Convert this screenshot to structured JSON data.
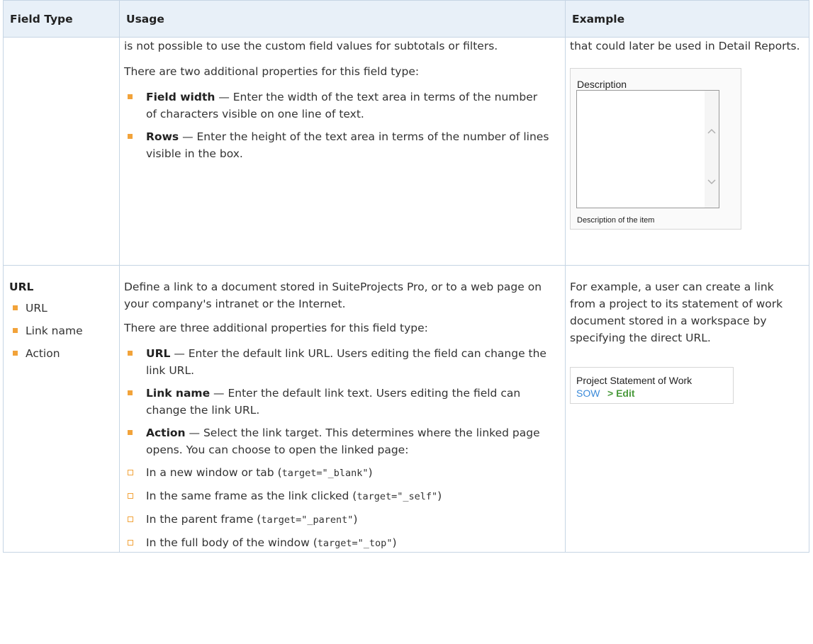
{
  "headers": {
    "field_type": "Field Type",
    "usage": "Usage",
    "example": "Example"
  },
  "row1": {
    "usage_intro": "is not possible to use the custom field values for subtotals or filters.",
    "usage_props_intro": "There are two additional properties for this field type:",
    "bullets": [
      {
        "term": "Field width",
        "text": " — Enter the width of the text area in terms of the number of characters visible on one line of text."
      },
      {
        "term": "Rows",
        "text": " — Enter the height of the text area in terms of the number of lines visible in the box."
      }
    ],
    "example_text": "that could later be used in Detail Reports.",
    "example_widget": {
      "label": "Description",
      "help": "Description of the item",
      "scroll_up_icon": "chevron-up-icon",
      "scroll_down_icon": "chevron-down-icon"
    }
  },
  "row2": {
    "field_type_title": "URL",
    "field_type_items": [
      "URL",
      "Link name",
      "Action"
    ],
    "usage_intro": "Define a link to a document stored in SuiteProjects Pro, or to a web page on your company's intranet or the Internet.",
    "usage_props_intro": "There are three additional properties for this field type:",
    "bullets": [
      {
        "term": "URL",
        "text": " — Enter the default link URL. Users editing the field can change the link URL."
      },
      {
        "term": "Link name",
        "text": " — Enter the default link text. Users editing the field can change the link URL."
      },
      {
        "term": "Action",
        "text": " — Select the link target. This determines where the linked page opens. You can choose to open the linked page:"
      }
    ],
    "sub_bullets": [
      {
        "text": "In a new window or tab (",
        "code": "target=\"_blank\"",
        "end": ")"
      },
      {
        "text": "In the same frame as the link clicked (",
        "code": "target=\"_self\"",
        "end": ")"
      },
      {
        "text": "In the parent frame (",
        "code": "target=\"_parent\"",
        "end": ")"
      },
      {
        "text": "In the full body of the window (",
        "code": "target=\"_top\"",
        "end": ")"
      }
    ],
    "example_text": "For example, a user can create a link from a project to its statement of work document stored in a workspace by specifying the direct URL.",
    "example_widget": {
      "title": "Project Statement of Work",
      "link": "SOW",
      "edit": "> Edit"
    }
  }
}
